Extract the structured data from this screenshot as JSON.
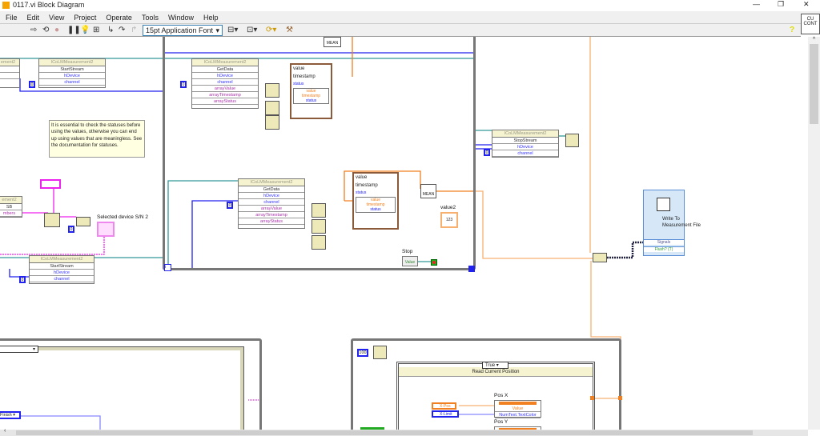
{
  "window": {
    "title": "0117.vi Block Diagram"
  },
  "menu": [
    "File",
    "Edit",
    "View",
    "Project",
    "Operate",
    "Tools",
    "Window",
    "Help"
  ],
  "toolbar": {
    "font": "15pt Application Font",
    "context_help": "CU\nCONT",
    "help_icon": "question-icon"
  },
  "colors": {
    "int_wire": "#2222ee",
    "dbl_wire": "#f08020",
    "string_wire": "#ee22ee",
    "refnum_wire": "#339999",
    "loop_border": "#777777"
  },
  "nodes": {
    "startstream_top": {
      "class": "ICoLMMeasurement2",
      "method": "StartStream",
      "rows": [
        "hDevice",
        "channel"
      ],
      "const": "0"
    },
    "getdata1": {
      "class": "ICoLMMeasurement2",
      "method": "GetData",
      "rows": [
        "hDevice",
        "channel",
        "arrayValue",
        "arrayTimestamp",
        "arrayStatus"
      ],
      "const": "0"
    },
    "getdata2": {
      "class": "ICoLMMeasurement2",
      "method": "GetData",
      "rows": [
        "hDevice",
        "channel",
        "arrayValue",
        "arrayTimestamp",
        "arrayStatus"
      ],
      "const": "0"
    },
    "stopstream": {
      "class": "ICoLMMeasurement2",
      "method": "StopStream",
      "rows": [
        "hDevice",
        "channel"
      ],
      "const": "0"
    },
    "startstream_bottom": {
      "class": "ICoLMMeasurement2",
      "method": "StartStream",
      "rows": [
        "hDevice",
        "channel"
      ],
      "const": "0"
    },
    "left_partial": {
      "rows": [
        "ement2",
        "SB",
        "mbers"
      ]
    }
  },
  "clusters": {
    "c1": {
      "value": "value",
      "timestamp": "timestamp",
      "status": "status",
      "unbundle": [
        "value",
        "timestamp",
        "status"
      ]
    },
    "c2": {
      "value": "value",
      "timestamp": "timestamp",
      "status": "status",
      "unbundle": [
        "value",
        "timestamp",
        "status"
      ]
    }
  },
  "mean_label": "MEAN",
  "comment": "It is essential to check the statuses before using the values, otherwise you can end up using values that are meaningless. See the documentation for statuses.",
  "selected_device_label": "Selected device S/N 2",
  "value2_label": "value2",
  "value2_display": "123",
  "stop": {
    "label": "Stop",
    "value": "Value"
  },
  "write_file": {
    "title": "Write To Measurement File",
    "inputs": [
      "Signals",
      "Flush? (T)"
    ]
  },
  "bottom": {
    "wait_ms": "100",
    "case_selector": "True",
    "case_label": "Read Current Position",
    "xpos": "X-Pos",
    "xlimit": "X-Limit",
    "posx_label": "Pos X",
    "posx_rows": [
      "Value",
      "NumText.TextColor"
    ],
    "posy_label": "Pos Y",
    "finish_enum": "Finish"
  }
}
